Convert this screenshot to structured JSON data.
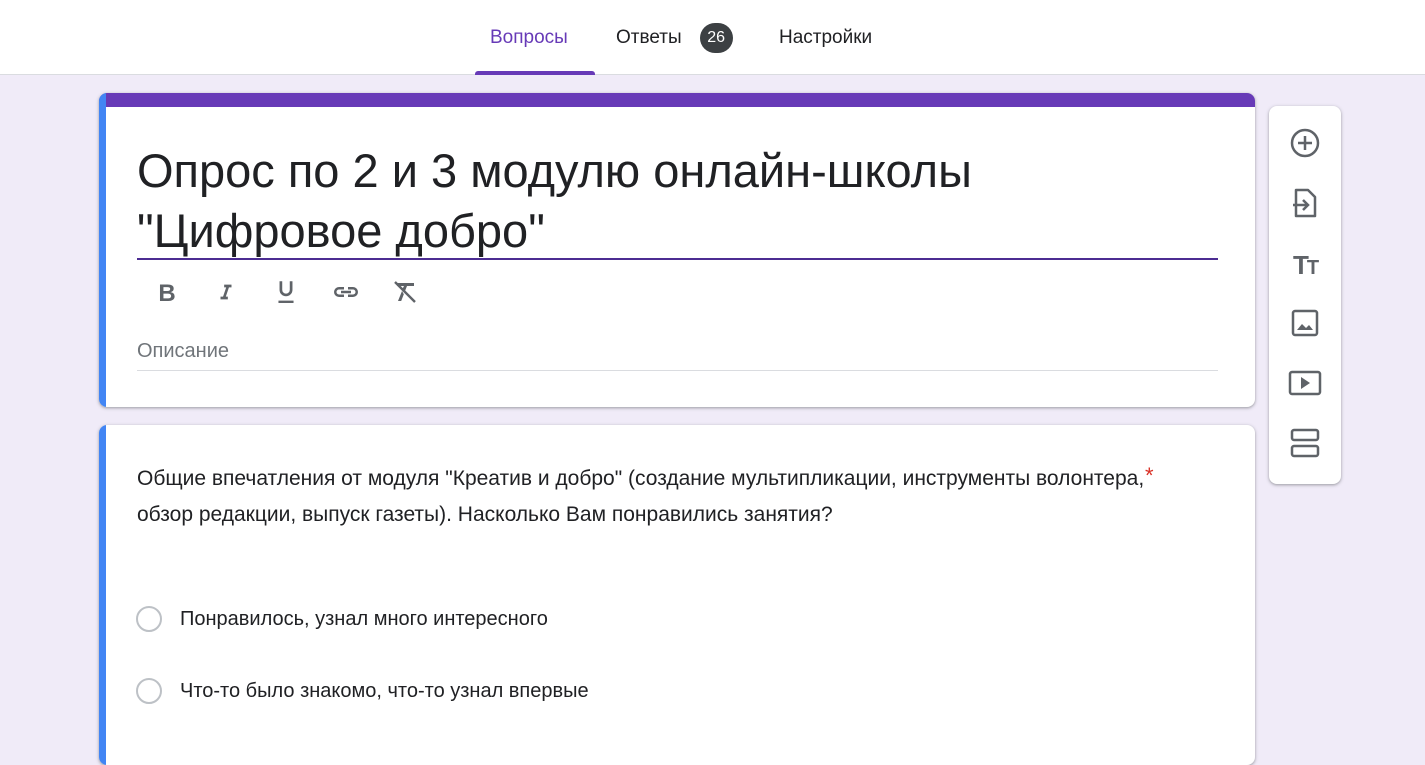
{
  "tabs": {
    "questions": "Вопросы",
    "answers": "Ответы",
    "answers_count": "26",
    "settings": "Настройки"
  },
  "form": {
    "title": "Опрос по 2 и 3 модулю онлайн-школы \"Цифровое добро\"",
    "description_placeholder": "Описание",
    "format_buttons": [
      "bold-icon",
      "italic-icon",
      "underline-icon",
      "link-icon",
      "clear-format-icon"
    ]
  },
  "question": {
    "text": "Общие впечатления от  модуля \"Креатив и добро\" (создание мультипликации, инструменты волонтера, обзор редакции, выпуск газеты). Насколько Вам понравились занятия?",
    "required_mark": "*",
    "options": [
      "Понравилось, узнал много интересного",
      "Что-то было знакомо, что-то узнал впервые"
    ]
  },
  "side_toolbar": [
    "add-question-icon",
    "import-questions-icon",
    "add-title-icon",
    "add-image-icon",
    "add-video-icon",
    "add-section-icon"
  ],
  "colors": {
    "accent": "#673ab7",
    "background": "#f0ebf8",
    "focus_bar": "#4285f4",
    "required": "#d93025"
  }
}
